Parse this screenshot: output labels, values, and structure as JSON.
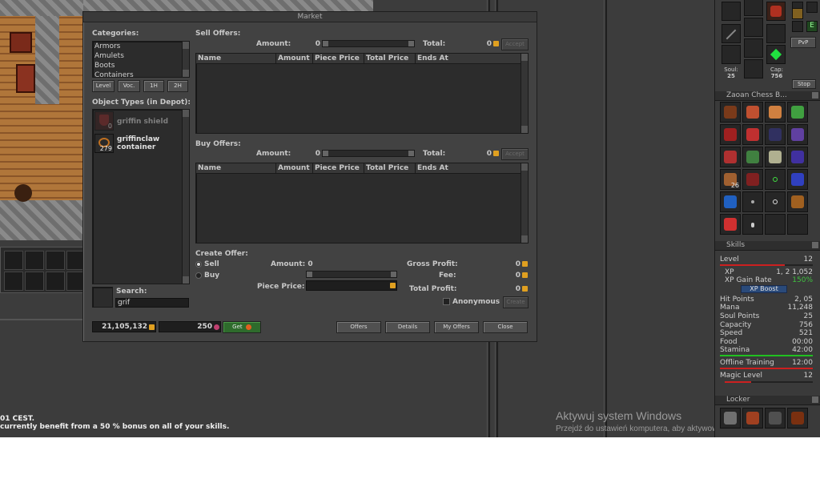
{
  "market": {
    "title": "Market",
    "categories_label": "Categories:",
    "categories": [
      "Armors",
      "Amulets",
      "Boots",
      "Containers"
    ],
    "filter_buttons": [
      "Level",
      "Voc.",
      "1H",
      "2H"
    ],
    "object_types_label": "Object Types (in Depot):",
    "object_types": [
      {
        "name": "griffin shield",
        "count": "0"
      },
      {
        "name": "griffinclaw\ncontainer",
        "count": "279"
      }
    ],
    "search_label": "Search:",
    "search_value": "grif",
    "balance": "21,105,132",
    "tc_amount": "250",
    "get_label": "Get",
    "sell_offers_label": "Sell Offers:",
    "buy_offers_label": "Buy Offers:",
    "amount_label": "Amount:",
    "total_label": "Total:",
    "sell_amount": "0",
    "sell_total": "0",
    "buy_amount": "0",
    "buy_total": "0",
    "accept_label": "Accept",
    "columns": [
      "Name",
      "Amount",
      "Piece Price",
      "Total Price",
      "Ends At"
    ],
    "create_offer_label": "Create Offer:",
    "sell_radio": "Sell",
    "buy_radio": "Buy",
    "create_amount_label": "Amount: 0",
    "piece_price_label": "Piece Price:",
    "gross_profit_label": "Gross Profit:",
    "gross_profit": "0",
    "fee_label": "Fee:",
    "fee": "0",
    "total_profit_label": "Total Profit:",
    "total_profit": "0",
    "anonymous_label": "Anonymous",
    "create_label": "Create",
    "footer_buttons": [
      "Offers",
      "Details",
      "My Offers",
      "Close"
    ]
  },
  "chat": {
    "line1": "01 CEST.",
    "line2": "currently benefit from a 50 % bonus on all of your skills."
  },
  "watermark": {
    "line1": "Aktywuj system Windows",
    "line2": "Przejdź do ustawień komputera, aby aktywować system"
  },
  "equipment": {
    "soul_label": "Soul:",
    "soul": "25",
    "cap_label": "Cap:",
    "cap": "756",
    "stop_label": "Stop",
    "pvp_label": "PvP"
  },
  "backpack": {
    "title": "Zaoan Chess B...",
    "stack_count": "26"
  },
  "skills": {
    "title": "Skills",
    "level_label": "Level",
    "level": "12",
    "xp_label": "XP",
    "xp": "1,     2  1,052",
    "xp_gain_label": "XP Gain Rate",
    "xp_gain": "150%",
    "xp_boost_label": "XP Boost",
    "rows": [
      {
        "label": "Hit Points",
        "value": "2, 05"
      },
      {
        "label": "Mana",
        "value": "11,248"
      },
      {
        "label": "Soul Points",
        "value": "25"
      },
      {
        "label": "Capacity",
        "value": "756"
      },
      {
        "label": "Speed",
        "value": "521"
      },
      {
        "label": "Food",
        "value": "00:00"
      },
      {
        "label": "Stamina",
        "value": "42:00"
      }
    ],
    "offline_label": "Offline Training",
    "offline": "12:00",
    "magic_label": "Magic Level",
    "magic": "12"
  },
  "locker": {
    "title": "Locker"
  },
  "colors": {
    "accent_green": "#2e6b2c",
    "coin": "#e0a020",
    "level_bar": "#cc2020",
    "stamina_bar": "#20c020"
  }
}
